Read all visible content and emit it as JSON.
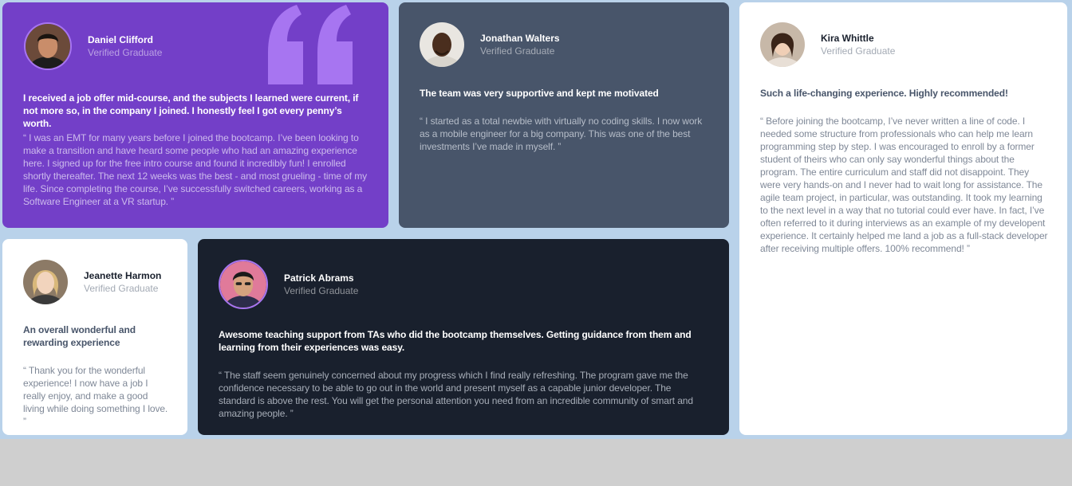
{
  "colors": {
    "purple": "#733fc8",
    "slate": "#48556a",
    "white": "#ffffff",
    "dark": "#19202d",
    "background": "#b9d2ea",
    "quote_accent": "#a775f1"
  },
  "testimonials": [
    {
      "name": "Daniel Clifford",
      "status": "Verified Graduate",
      "headline": "I received a job offer mid-course, and the subjects I learned were current, if not more so, in the company I joined. I honestly feel I got every penny’s worth.",
      "body": "“ I was an EMT for many years before I joined the bootcamp. I’ve been looking to make a transition and have heard some people who had an amazing experience here. I signed up for the free intro course and found it incredibly fun! I enrolled shortly thereafter. The next 12 weeks was the best - and most grueling - time of my life. Since completing the course, I’ve successfully switched careers, working as a Software Engineer at a VR startup. ”"
    },
    {
      "name": "Jonathan Walters",
      "status": "Verified Graduate",
      "headline": "The team was very supportive and kept me motivated",
      "body": "“ I started as a total newbie with virtually no coding skills. I now work as a mobile engineer for a big company. This was one of the best investments I’ve made in myself. ”"
    },
    {
      "name": "Kira Whittle",
      "status": "Verified Graduate",
      "headline": "Such a life-changing experience. Highly recommended!",
      "body": "“ Before joining the bootcamp, I’ve never written a line of code. I needed some structure from professionals who can help me learn programming step by step. I was encouraged to enroll by a former student of theirs who can only say wonderful things about the program. The entire curriculum and staff did not disappoint. They were very hands-on and I never had to wait long for assistance. The agile team project, in particular, was outstanding. It took my learning to the next level in a way that no tutorial could ever have. In fact, I’ve often referred to it during interviews as an example of my developent experience. It certainly helped me land a job as a full-stack developer after receiving multiple offers. 100% recommend! ”"
    },
    {
      "name": "Jeanette Harmon",
      "status": "Verified Graduate",
      "headline": "An overall wonderful and rewarding experience",
      "body": "“ Thank you for the wonderful experience! I now have a job I really enjoy, and make a good living while doing something I love. ”"
    },
    {
      "name": "Patrick Abrams",
      "status": "Verified Graduate",
      "headline": "Awesome teaching support from TAs who did the bootcamp themselves. Getting guidance from them and learning from their experiences was easy.",
      "body": "“ The staff seem genuinely concerned about my progress which I find really refreshing. The program gave me the confidence necessary to be able to go out in the world and present myself as a capable junior developer. The standard is above the rest. You will get the personal attention you need from an incredible community of smart and amazing people. ”"
    }
  ]
}
